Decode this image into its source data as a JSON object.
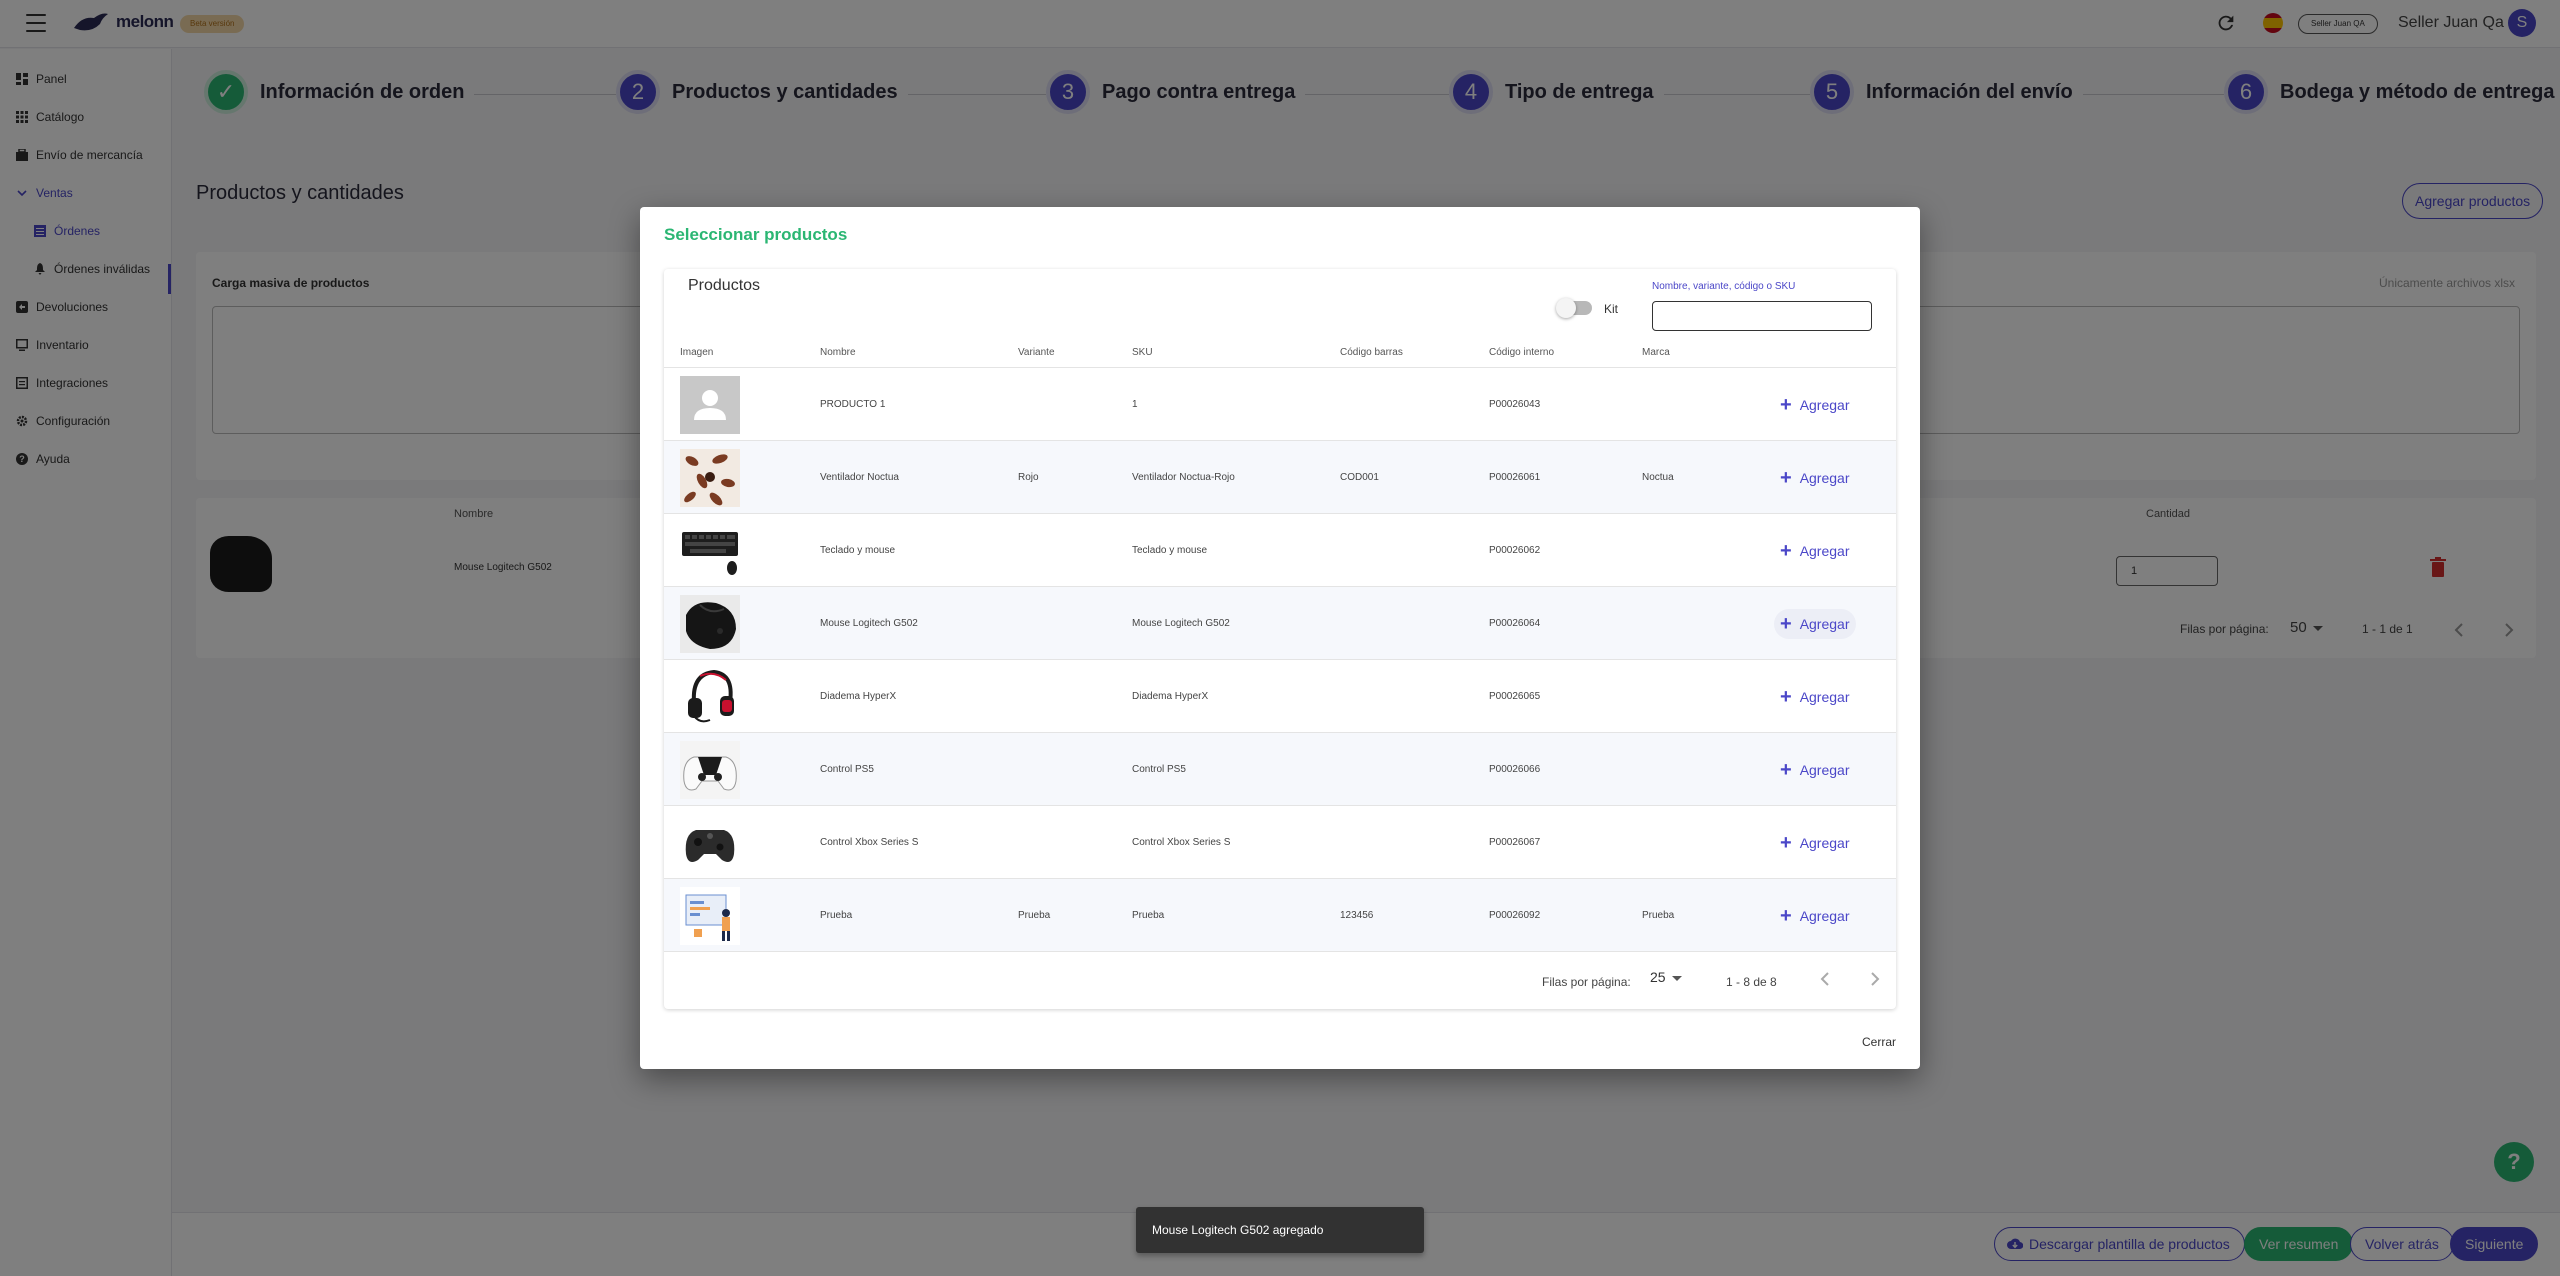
{
  "header": {
    "logo_text": "melonn",
    "env_badge": "Beta versión",
    "seller_chip": "Seller Juan QA",
    "seller_name": "Seller Juan Qa",
    "avatar_initial": "S"
  },
  "sidebar": {
    "items": [
      {
        "label": "Panel",
        "icon": "dashboard-icon"
      },
      {
        "label": "Catálogo",
        "icon": "grid-icon"
      },
      {
        "label": "Envío de mercancía",
        "icon": "box-icon"
      },
      {
        "label": "Ventas",
        "icon": "chevron-down-icon"
      },
      {
        "label": "Órdenes",
        "icon": "list-icon"
      },
      {
        "label": "Órdenes inválidas",
        "icon": "bell-icon"
      },
      {
        "label": "Devoluciones",
        "icon": "return-icon"
      },
      {
        "label": "Inventario",
        "icon": "monitor-icon"
      },
      {
        "label": "Integraciones",
        "icon": "integrations-icon"
      },
      {
        "label": "Configuración",
        "icon": "gear-icon"
      },
      {
        "label": "Ayuda",
        "icon": "help-icon"
      }
    ]
  },
  "stepper": {
    "steps": [
      {
        "num": "✓",
        "label": "Información de orden",
        "done": true
      },
      {
        "num": "2",
        "label": "Productos y cantidades"
      },
      {
        "num": "3",
        "label": "Pago contra entrega"
      },
      {
        "num": "4",
        "label": "Tipo de entrega"
      },
      {
        "num": "5",
        "label": "Información del envío"
      },
      {
        "num": "6",
        "label": "Bodega y método de entrega"
      }
    ]
  },
  "page": {
    "title": "Productos y cantidades",
    "add_products": "Agregar productos",
    "carga_title": "Carga masiva de productos",
    "carga_hint": "Únicamente archivos xlsx",
    "col_nombre": "Nombre",
    "col_cantidad": "Cantidad",
    "row_name": "Mouse Logitech G502",
    "row_qty": "1",
    "rows_per_page_label": "Filas por página:",
    "rows_per_page": "50",
    "range": "1 - 1 de 1"
  },
  "footer": {
    "download_template": "Descargar plantilla de productos",
    "summary": "Ver resumen",
    "back": "Volver atrás",
    "next": "Siguiente"
  },
  "modal": {
    "title": "Seleccionar productos",
    "panel_title": "Productos",
    "kit_label": "Kit",
    "search_label": "Nombre, variante, código o SKU",
    "search_value": "",
    "columns": [
      "Imagen",
      "Nombre",
      "Variante",
      "SKU",
      "Código barras",
      "Código interno",
      "Marca"
    ],
    "add_label": "Agregar",
    "rows": [
      {
        "nombre": "PRODUCTO 1",
        "variante": "",
        "sku": "1",
        "barras": "",
        "interno": "P00026043",
        "marca": "",
        "img": "placeholder"
      },
      {
        "nombre": "Ventilador Noctua",
        "variante": "Rojo",
        "sku": "Ventilador Noctua-Rojo",
        "barras": "COD001",
        "interno": "P00026061",
        "marca": "Noctua",
        "img": "fans"
      },
      {
        "nombre": "Teclado y mouse",
        "variante": "",
        "sku": "Teclado y mouse",
        "barras": "",
        "interno": "P00026062",
        "marca": "",
        "img": "keyboard"
      },
      {
        "nombre": "Mouse Logitech G502",
        "variante": "",
        "sku": "Mouse Logitech G502",
        "barras": "",
        "interno": "P00026064",
        "marca": "",
        "img": "mouse"
      },
      {
        "nombre": "Diadema HyperX",
        "variante": "",
        "sku": "Diadema HyperX",
        "barras": "",
        "interno": "P00026065",
        "marca": "",
        "img": "headset"
      },
      {
        "nombre": "Control PS5",
        "variante": "",
        "sku": "Control PS5",
        "barras": "",
        "interno": "P00026066",
        "marca": "",
        "img": "ps5"
      },
      {
        "nombre": "Control Xbox Series S",
        "variante": "",
        "sku": "Control Xbox Series S",
        "barras": "",
        "interno": "P00026067",
        "marca": "",
        "img": "xbox"
      },
      {
        "nombre": "Prueba",
        "variante": "Prueba",
        "sku": "Prueba",
        "barras": "123456",
        "interno": "P00026092",
        "marca": "Prueba",
        "img": "illustration"
      }
    ],
    "rows_per_page_label": "Filas por página:",
    "rows_per_page": "25",
    "range": "1 - 8 de 8",
    "close": "Cerrar"
  },
  "snackbar": {
    "message": "Mouse Logitech G502 agregado"
  },
  "colors": {
    "primary": "#4b47c8",
    "success": "#2bb673",
    "danger": "#d32f2f"
  }
}
